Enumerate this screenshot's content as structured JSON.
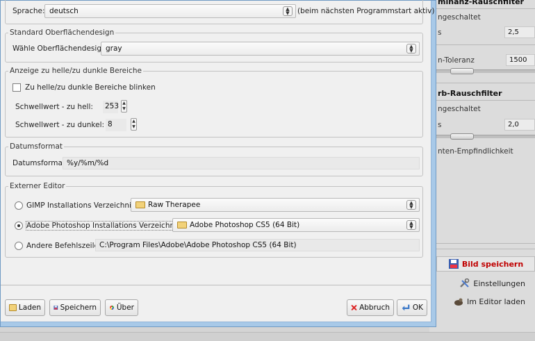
{
  "right_panel": {
    "luminance_header": "minanz-Rauschfilter",
    "luminance_state": "ngeschaltet",
    "luminance_s_label": "s",
    "luminance_s_value": "2,5",
    "tolerance_label": "n-Toleranz",
    "tolerance_value": "1500",
    "chroma_header": "rb-Rauschfilter",
    "chroma_state": "ngeschaltet",
    "chroma_s_label": "s",
    "chroma_s_value": "2,0",
    "edge_label": "nten-Empfindlichkeit",
    "save_button": "Bild speichern",
    "settings_button": "Einstellungen",
    "editor_button": "Im Editor laden"
  },
  "language": {
    "label": "Sprache:",
    "value": "deutsch",
    "note": "(beim nächsten Programmstart aktiv)"
  },
  "theme_group": {
    "legend": "Standard Oberflächendesign",
    "label": "Wähle Oberflächendesign:",
    "value": "gray"
  },
  "clipping_group": {
    "legend": "Anzeige zu helle/zu dunkle Bereiche",
    "blink_label": "Zu helle/zu dunkle Bereiche blinken",
    "bright_label": "Schwellwert - zu hell:",
    "bright_value": "253",
    "dark_label": "Schwellwert - zu dunkel:",
    "dark_value": "8"
  },
  "date_group": {
    "legend": "Datumsformat",
    "label": "Datumsformat:",
    "value": "%y/%m/%d"
  },
  "editor_group": {
    "legend": "Externer Editor",
    "gimp_label": "GIMP Installations Verzeichnis:",
    "gimp_value": "Raw Therapee",
    "ps_label": "Adobe Photoshop Installations Verzeichnis:",
    "ps_value": "Adobe Photoshop CS5 (64 Bit)",
    "other_label": "Andere Befehlszeile:",
    "other_value": "C:\\Program Files\\Adobe\\Adobe Photoshop CS5 (64 Bit)"
  },
  "buttons": {
    "load": "Laden",
    "save": "Speichern",
    "about": "Über",
    "cancel": "Abbruch",
    "ok": "OK"
  },
  "colors": {
    "accent_red": "#c00000",
    "dialog_frame": "#a8c9e8"
  }
}
